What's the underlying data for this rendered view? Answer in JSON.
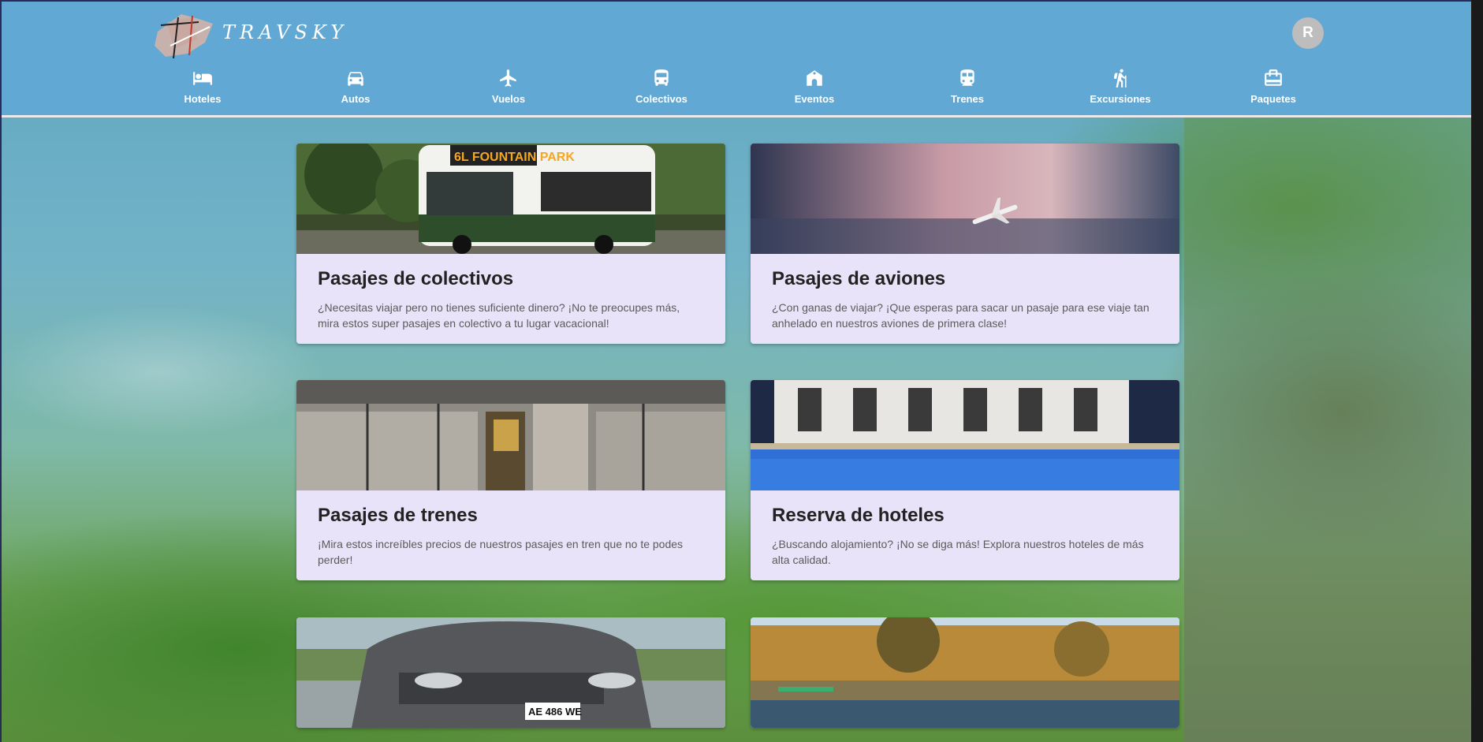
{
  "brand": {
    "name": "TRAVSKY"
  },
  "user": {
    "avatar_initial": "R"
  },
  "nav": [
    {
      "label": "Hoteles",
      "icon": "bed-icon"
    },
    {
      "label": "Autos",
      "icon": "car-icon"
    },
    {
      "label": "Vuelos",
      "icon": "airplane-icon"
    },
    {
      "label": "Colectivos",
      "icon": "bus-icon"
    },
    {
      "label": "Eventos",
      "icon": "event-venue-icon"
    },
    {
      "label": "Trenes",
      "icon": "train-icon"
    },
    {
      "label": "Excursiones",
      "icon": "hiking-icon"
    },
    {
      "label": "Paquetes",
      "icon": "luggage-icon"
    }
  ],
  "cards": [
    {
      "title": "Pasajes de colectivos",
      "description": "¿Necesitas viajar pero no tienes suficiente dinero? ¡No te preocupes más, mira estos super pasajes en colectivo a tu lugar vacacional!",
      "image": "bus-photo"
    },
    {
      "title": "Pasajes de aviones",
      "description": "¿Con ganas de viajar? ¡Que esperas para sacar un pasaje para ese viaje tan anhelado en nuestros aviones de primera clase!",
      "image": "airplane-photo"
    },
    {
      "title": "Pasajes de trenes",
      "description": "¡Mira estos increíbles precios de nuestros pasajes en tren que no te podes perder!",
      "image": "train-station-photo"
    },
    {
      "title": "Reserva de hoteles",
      "description": "¿Buscando alojamiento? ¡No se diga más! Explora nuestros hoteles de más alta calidad.",
      "image": "hotel-pool-photo"
    },
    {
      "title": "",
      "description": "",
      "image": "car-photo"
    },
    {
      "title": "",
      "description": "",
      "image": "lake-photo"
    }
  ],
  "colors": {
    "header": "#62a8d5",
    "card": "#e8e3f8",
    "avatar": "#bdbdbd"
  }
}
